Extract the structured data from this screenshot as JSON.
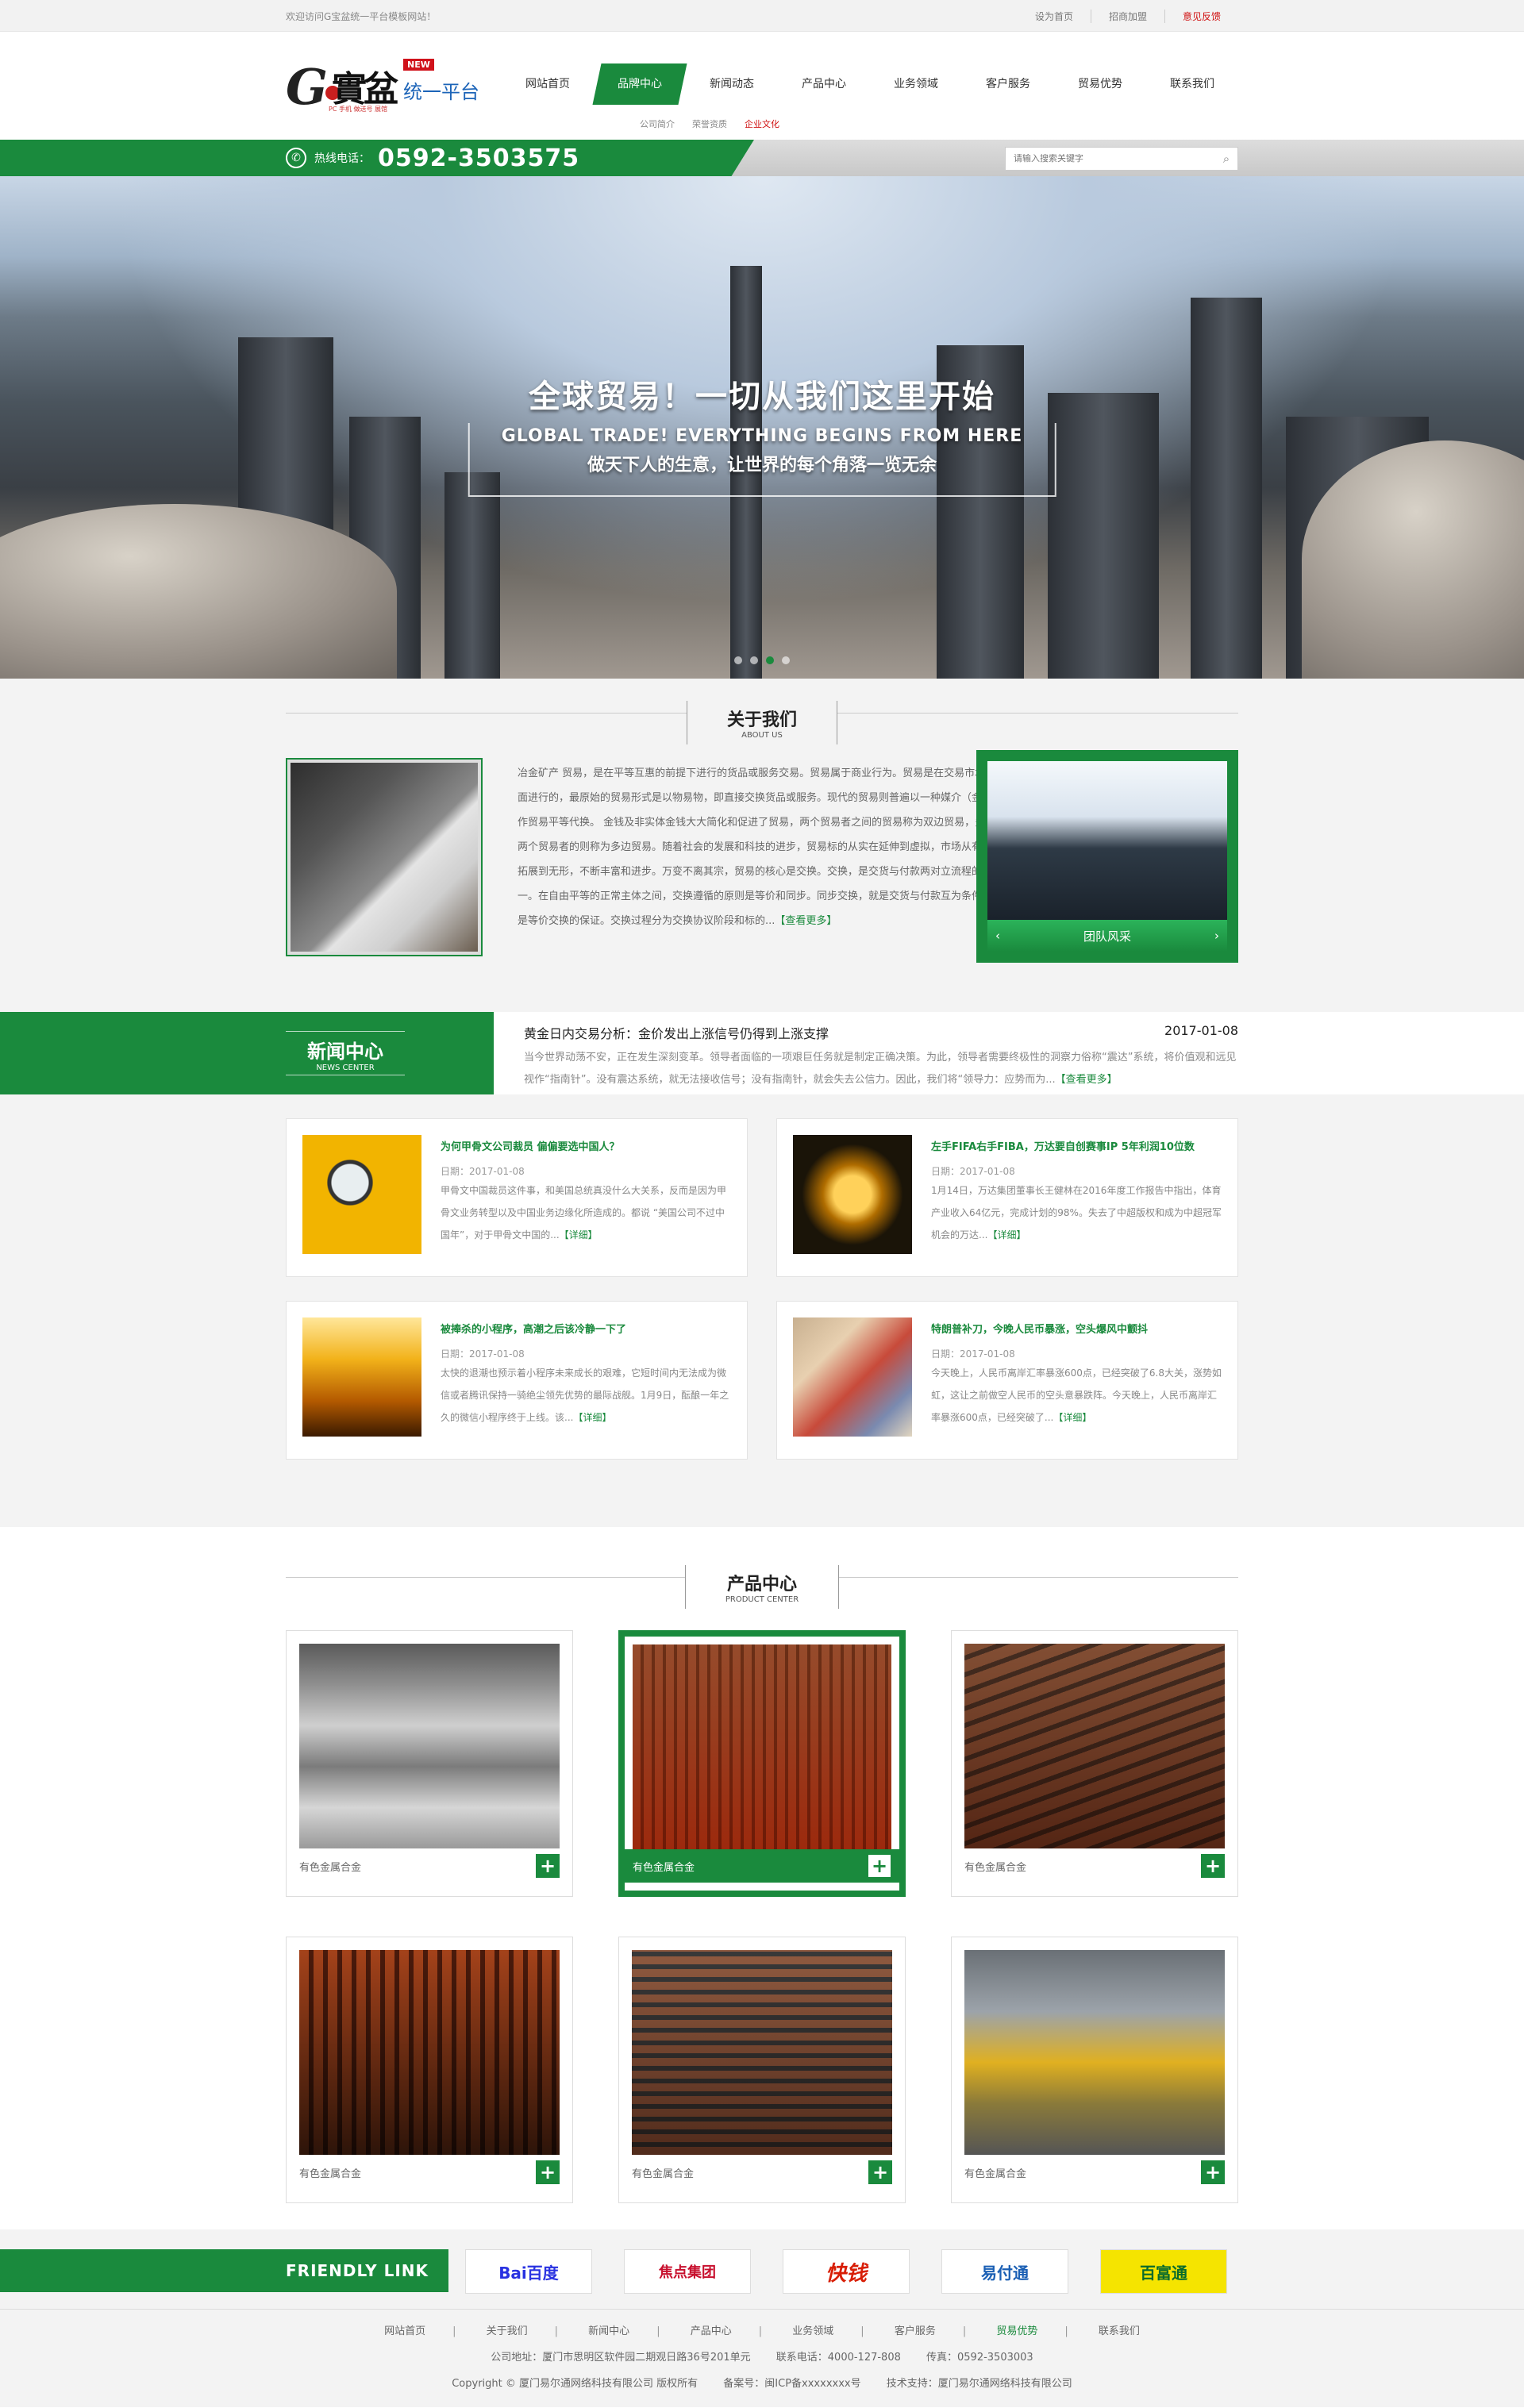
{
  "topbar": {
    "welcome": "欢迎访问G宝盆统一平台模板网站！",
    "links": [
      "设为首页",
      "招商加盟",
      "意见反馈"
    ]
  },
  "logo": {
    "g": "G",
    "cn": "實盆",
    "new": "NEW",
    "tong": "统一平台",
    "sub": "PC 手机 做送号 展馆"
  },
  "nav": {
    "items": [
      "网站首页",
      "品牌中心",
      "新闻动态",
      "产品中心",
      "业务领域",
      "客户服务",
      "贸易优势",
      "联系我们"
    ],
    "active_index": 1,
    "sub": [
      "公司简介",
      "荣誉资质",
      "企业文化"
    ]
  },
  "phone": {
    "label": "热线电话：",
    "number": "0592-3503575"
  },
  "search": {
    "placeholder": "请输入搜索关键字"
  },
  "banner": {
    "title": "全球贸易！一切从我们这里开始",
    "en": "GLOBAL TRADE! EVERYTHING BEGINS FROM HERE",
    "slogan": "做天下人的生意，让世界的每个角落一览无余"
  },
  "about": {
    "title": "关于我们",
    "en": "ABOUT US",
    "text": "冶金矿产 贸易，是在平等互惠的前提下进行的货品或服务交易。贸易属于商业行为。贸易是在交易市场里面进行的，最原始的贸易形式是以物易物，即直接交换货品或服务。现代的贸易则普遍以一种媒介（金钱）作贸易平等代换。 金钱及非实体金钱大大简化和促进了贸易，两个贸易者之间的贸易称为双边贸易，多于两个贸易者的则称为多边贸易。随着社会的发展和科技的进步，贸易标的从实在延伸到虚拟，市场从有形拓展到无形，不断丰富和进步。万变不离其宗，贸易的核心是交换。交换，是交货与付款两对立流程的统一。在自由平等的正常主体之间，交换遵循的原则是等价和同步。同步交换，就是交货与付款互为条件，是等价交换的保证。交换过程分为交换协议阶段和标的...",
    "more": "【查看更多】",
    "team_caption": "团队风采"
  },
  "news": {
    "title": "新闻中心",
    "en": "NEWS CENTER",
    "headline": {
      "title": "黄金日内交易分析：金价发出上涨信号仍得到上涨支撑",
      "date": "2017-01-08",
      "desc": "当今世界动荡不安，正在发生深刻变革。领导者面临的一项艰巨任务就是制定正确决策。为此，领导者需要终极性的洞察力俗称“震达”系统，将价值观和远见视作“指南针”。没有震达系统，就无法接收信号；没有指南针，就会失去公信力。因此，我们将“领导力：应势而为...",
      "more": "【查看更多】"
    },
    "items": [
      {
        "title": "为何甲骨文公司裁员 偏偏要选中国人？",
        "date": "日期：2017-01-08",
        "desc": "甲骨文中国裁员这件事，和美国总统真没什么大关系，反而是因为甲骨文业务转型以及中国业务边缘化所造成的。都说 “美国公司不过中国年”，对于甲骨文中国的...",
        "more": "【详细】"
      },
      {
        "title": "左手FIFA右手FIBA，万达要自创赛事IP 5年利润10位数",
        "date": "日期：2017-01-08",
        "desc": "1月14日，万达集团董事长王健林在2016年度工作报告中指出，体育产业收入64亿元，完成计划的98%。失去了中超版权和成为中超冠军机会的万达...",
        "more": "【详细】"
      },
      {
        "title": "被捧杀的小程序，高潮之后该冷静一下了",
        "date": "日期：2017-01-08",
        "desc": "太快的退潮也预示着小程序未来成长的艰难，它短时间内无法成为微信或者腾讯保持一骑绝尘领先优势的最际战舰。1月9日，酝酿一年之久的微信小程序终于上线。该...",
        "more": "【详细】"
      },
      {
        "title": "特朗普补刀，今晚人民币暴涨，空头爆风中颤抖",
        "date": "日期：2017-01-08",
        "desc": "今天晚上，人民币离岸汇率暴涨600点，已经突破了6.8大关，涨势如虹，这让之前做空人民币的空头意暴跌阵。今天晚上，人民币离岸汇率暴涨600点，已经突破了...",
        "more": "【详细】"
      }
    ]
  },
  "products": {
    "title": "产品中心",
    "en": "PRODUCT CENTER",
    "items": [
      {
        "label": "有色金属合金"
      },
      {
        "label": "有色金属合金"
      },
      {
        "label": "有色金属合金"
      },
      {
        "label": "有色金属合金"
      },
      {
        "label": "有色金属合金"
      },
      {
        "label": "有色金属合金"
      }
    ],
    "active_index": 1
  },
  "friendly": {
    "title": "FRIENDLY LINK",
    "logos": [
      "Bai百度",
      "焦点集团",
      "快钱",
      "易付通",
      "百富通"
    ]
  },
  "footer": {
    "nav": [
      "网站首页",
      "关于我们",
      "新闻中心",
      "产品中心",
      "业务领域",
      "客户服务",
      "贸易优势",
      "联系我们"
    ],
    "address": "公司地址：厦门市思明区软件园二期观日路36号201单元",
    "tel": "联系电话：4000-127-808",
    "fax": "传真：0592-3503003",
    "copyright": "Copyright © 厦门易尔通网络科技有限公司 版权所有",
    "icp": "备案号：闽ICP备xxxxxxxx号",
    "support": "技术支持：厦门易尔通网络科技有限公司"
  },
  "colors": {
    "brand_green": "#1a8a3d",
    "accent_red": "#d01010"
  }
}
